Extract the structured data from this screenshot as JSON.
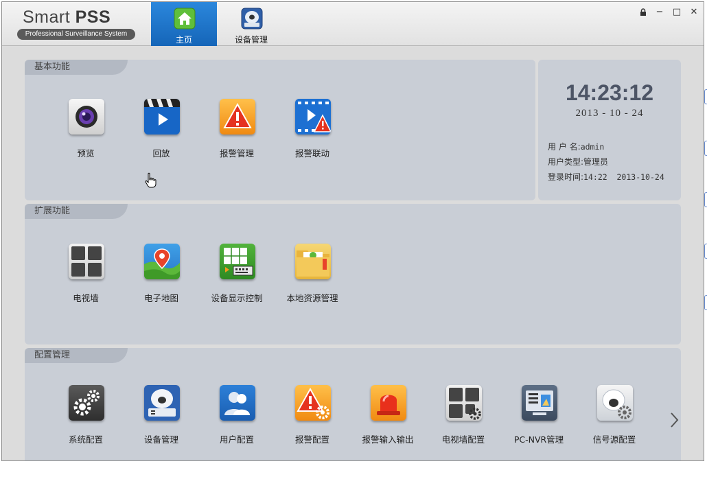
{
  "app": {
    "logo_title_light": "Smart ",
    "logo_title_bold": "PSS",
    "logo_subtitle": "Professional Surveillance System"
  },
  "nav": {
    "tabs": [
      {
        "label": "主页",
        "icon": "home-icon",
        "active": true
      },
      {
        "label": "设备管理",
        "icon": "device-camera-icon",
        "active": false
      }
    ]
  },
  "window_controls": {
    "lock": "🔒",
    "minimize": "−",
    "maximize": "□",
    "close": "✕"
  },
  "sections": {
    "basic": {
      "title": "基本功能",
      "items": [
        {
          "label": "预览",
          "icon": "camera-lens-icon"
        },
        {
          "label": "回放",
          "icon": "clapper-play-icon"
        },
        {
          "label": "报警管理",
          "icon": "alarm-warning-icon"
        },
        {
          "label": "报警联动",
          "icon": "alarm-link-icon"
        }
      ]
    },
    "extended": {
      "title": "扩展功能",
      "items": [
        {
          "label": "电视墙",
          "icon": "video-wall-icon"
        },
        {
          "label": "电子地图",
          "icon": "map-pin-icon"
        },
        {
          "label": "设备显示控制",
          "icon": "display-control-icon"
        },
        {
          "label": "本地资源管理",
          "icon": "folder-icon"
        }
      ]
    },
    "config": {
      "title": "配置管理",
      "items": [
        {
          "label": "系统配置",
          "icon": "gears-icon"
        },
        {
          "label": "设备管理",
          "icon": "device-camera-icon"
        },
        {
          "label": "用户配置",
          "icon": "users-icon"
        },
        {
          "label": "报警配置",
          "icon": "alarm-config-icon"
        },
        {
          "label": "报警输入输出",
          "icon": "siren-icon"
        },
        {
          "label": "电视墙配置",
          "icon": "video-wall-config-icon"
        },
        {
          "label": "PC-NVR管理",
          "icon": "pc-nvr-icon"
        },
        {
          "label": "信号源配置",
          "icon": "signal-source-icon"
        }
      ]
    }
  },
  "clock": {
    "time": "14:23:12",
    "date": "2013 - 10 - 24"
  },
  "user_info": {
    "username_label": "用 户 名:",
    "username": "admin",
    "type_label": "用户类型:",
    "type": "管理员",
    "login_label": "登录时间:",
    "login_time": "14:22  2013-10-24"
  },
  "colors": {
    "active_tab": "#1e74c9",
    "panel_bg": "#c9ced6",
    "panel_tab_bg": "#b3b9c3",
    "alarm_orange": "#f39a1c"
  }
}
